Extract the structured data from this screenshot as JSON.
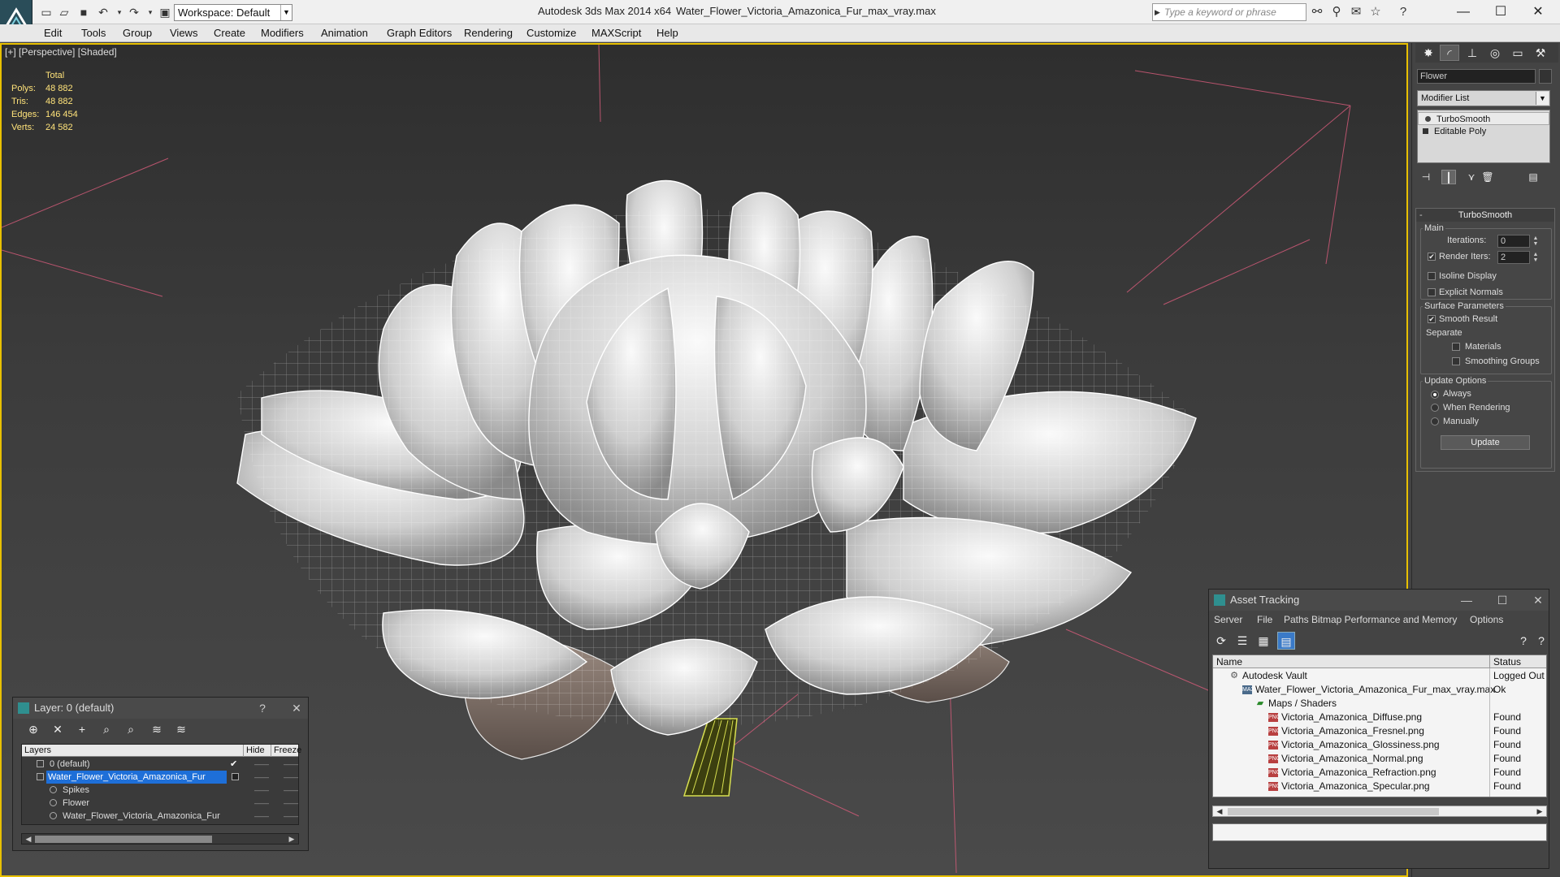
{
  "titlebar": {
    "app_title": "Autodesk 3ds Max  2014 x64",
    "file_title": "Water_Flower_Victoria_Amazonica_Fur_max_vray.max",
    "workspace_label": "Workspace: Default",
    "search_placeholder": "Type a keyword or phrase"
  },
  "menu": {
    "items": [
      "Edit",
      "Tools",
      "Group",
      "Views",
      "Create",
      "Modifiers",
      "Animation",
      "Graph Editors",
      "Rendering",
      "Customize",
      "MAXScript",
      "Help"
    ]
  },
  "viewport": {
    "label": "[+] [Perspective] [Shaded]",
    "stats_header": "Total",
    "stats": [
      {
        "key": "Polys:",
        "value": "48 882"
      },
      {
        "key": "Tris:",
        "value": "48 882"
      },
      {
        "key": "Edges:",
        "value": "146 454"
      },
      {
        "key": "Verts:",
        "value": "24 582"
      }
    ]
  },
  "command_panel": {
    "object_name": "Flower",
    "modifier_list": "Modifier List",
    "stack": [
      "TurboSmooth",
      "Editable Poly"
    ],
    "rollout_title": "TurboSmooth",
    "main_group": "Main",
    "iterations_label": "Iterations:",
    "iterations_value": "0",
    "render_iters_label": "Render Iters:",
    "render_iters_value": "2",
    "isoline_label": "Isoline Display",
    "explicit_normals_label": "Explicit Normals",
    "surface_group": "Surface Parameters",
    "smooth_result_label": "Smooth Result",
    "separate_label": "Separate",
    "materials_label": "Materials",
    "smoothing_groups_label": "Smoothing Groups",
    "update_group": "Update Options",
    "always_label": "Always",
    "when_rendering_label": "When Rendering",
    "manually_label": "Manually",
    "update_button": "Update"
  },
  "layer_panel": {
    "title": "Layer: 0 (default)",
    "help": "?",
    "columns": [
      "Layers",
      "Hide",
      "Freeze"
    ],
    "rows": [
      {
        "name": "0 (default)"
      },
      {
        "name": "Water_Flower_Victoria_Amazonica_Fur"
      },
      {
        "name": "Spikes"
      },
      {
        "name": "Flower"
      },
      {
        "name": "Water_Flower_Victoria_Amazonica_Fur"
      }
    ]
  },
  "asset_panel": {
    "title": "Asset Tracking",
    "menu": [
      "Server",
      "File",
      "Paths",
      "Bitmap Performance and Memory",
      "Options"
    ],
    "columns": [
      "Name",
      "Status"
    ],
    "rows": [
      {
        "name": "Autodesk Vault",
        "status": "Logged Out"
      },
      {
        "name": "Water_Flower_Victoria_Amazonica_Fur_max_vray.max",
        "status": "Ok"
      },
      {
        "name": "Maps / Shaders",
        "status": ""
      },
      {
        "name": "Victoria_Amazonica_Diffuse.png",
        "status": "Found"
      },
      {
        "name": "Victoria_Amazonica_Fresnel.png",
        "status": "Found"
      },
      {
        "name": "Victoria_Amazonica_Glossiness.png",
        "status": "Found"
      },
      {
        "name": "Victoria_Amazonica_Normal.png",
        "status": "Found"
      },
      {
        "name": "Victoria_Amazonica_Refraction.png",
        "status": "Found"
      },
      {
        "name": "Victoria_Amazonica_Specular.png",
        "status": "Found"
      }
    ]
  },
  "colors": {
    "accent": "#e8c000",
    "selection": "#1e6fd8",
    "stats": "#ffe37a"
  }
}
